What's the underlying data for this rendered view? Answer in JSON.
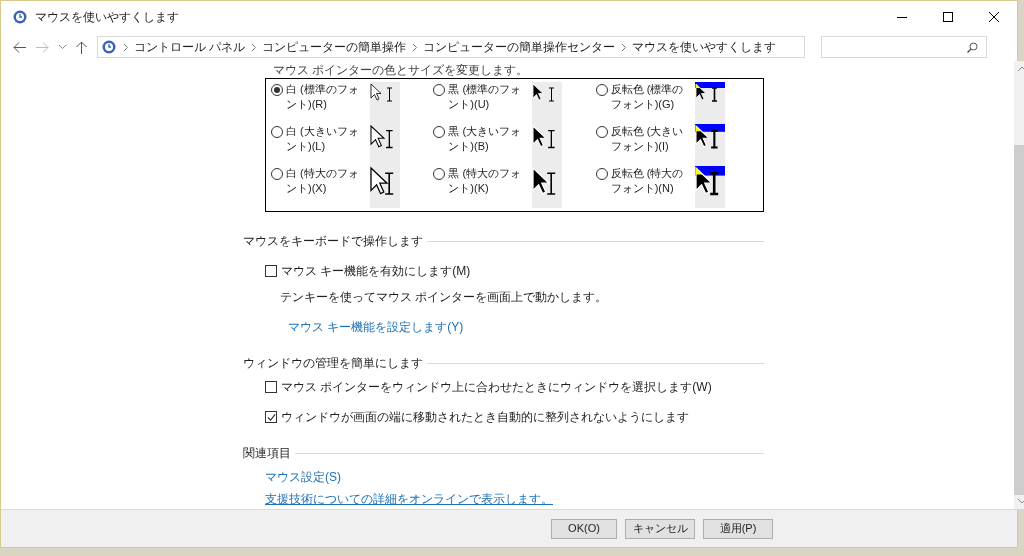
{
  "window": {
    "title": "マウスを使いやすくします"
  },
  "breadcrumb": [
    "コントロール パネル",
    "コンピューターの簡単操作",
    "コンピューターの簡単操作センター",
    "マウスを使いやすくします"
  ],
  "pointer_section": {
    "heading": "マウス ポインターの色とサイズを変更します。",
    "options": [
      {
        "label": "白 (標準のフォント)(R)",
        "kind": "white-standard",
        "selected": true
      },
      {
        "label": "黒 (標準のフォント)(U)",
        "kind": "black-standard",
        "selected": false
      },
      {
        "label": "反転色 (標準のフォント)(G)",
        "kind": "inverted-standard",
        "selected": false
      },
      {
        "label": "白 (大きいフォント)(L)",
        "kind": "white-large",
        "selected": false
      },
      {
        "label": "黒 (大きいフォント)(B)",
        "kind": "black-large",
        "selected": false
      },
      {
        "label": "反転色 (大きいフォント)(I)",
        "kind": "inverted-large",
        "selected": false
      },
      {
        "label": "白 (特大のフォント)(X)",
        "kind": "white-extra",
        "selected": false
      },
      {
        "label": "黒 (特大のフォント)(K)",
        "kind": "black-extra",
        "selected": false
      },
      {
        "label": "反転色 (特大のフォント)(N)",
        "kind": "inverted-extra",
        "selected": false
      }
    ]
  },
  "keyboard_section": {
    "heading": "マウスをキーボードで操作します",
    "checkbox": {
      "label": "マウス キー機能を有効にします(M)",
      "checked": false
    },
    "description": "テンキーを使ってマウス ポインターを画面上で動かします。",
    "link": "マウス キー機能を設定します(Y)"
  },
  "window_section": {
    "heading": "ウィンドウの管理を簡単にします",
    "checkboxes": [
      {
        "label": "マウス ポインターをウィンドウ上に合わせたときにウィンドウを選択します(W)",
        "checked": false
      },
      {
        "label": "ウィンドウが画面の端に移動されたとき自動的に整列されないようにします",
        "checked": true
      }
    ]
  },
  "related_section": {
    "heading": "関連項目",
    "links": [
      "マウス設定(S)",
      "支援技術についての詳細をオンラインで表示します。"
    ]
  },
  "buttons": [
    "OK(O)",
    "キャンセル",
    "適用(P)"
  ]
}
